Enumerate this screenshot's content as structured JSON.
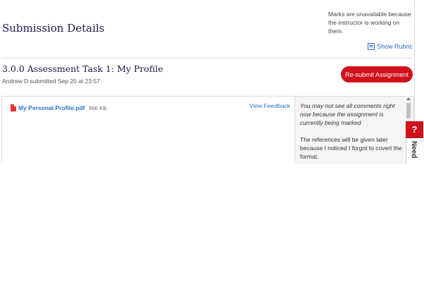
{
  "header": {
    "title": "Submission Details",
    "marks_note": "Marks are unavailable because the instructor is working on them.",
    "show_rubric": "Show Rubric"
  },
  "task": {
    "title": "3.0.0 Assessment Task 1: My Profile",
    "submitted": "Andrew D submitted Sep 20 at 23:57",
    "resubmit_label": "Re-submit Assignment"
  },
  "file": {
    "name": "My Personal Profile.pdf",
    "size": "506 KB",
    "view_feedback": "View Feedback"
  },
  "comments": {
    "notice": "You may not see all comments right now because the assignment is currently being marked",
    "body": "The references will be given later because I noticed I forgot to covert the format."
  },
  "help": {
    "icon_label": "?",
    "tab_label": "Need"
  },
  "colors": {
    "accent_red": "#d0101b",
    "link_blue": "#2d73c7",
    "heading_navy": "#1a1a4a"
  },
  "icons": [
    "rubric-icon",
    "pdf-icon",
    "help-icon",
    "scroll-up-icon"
  ]
}
